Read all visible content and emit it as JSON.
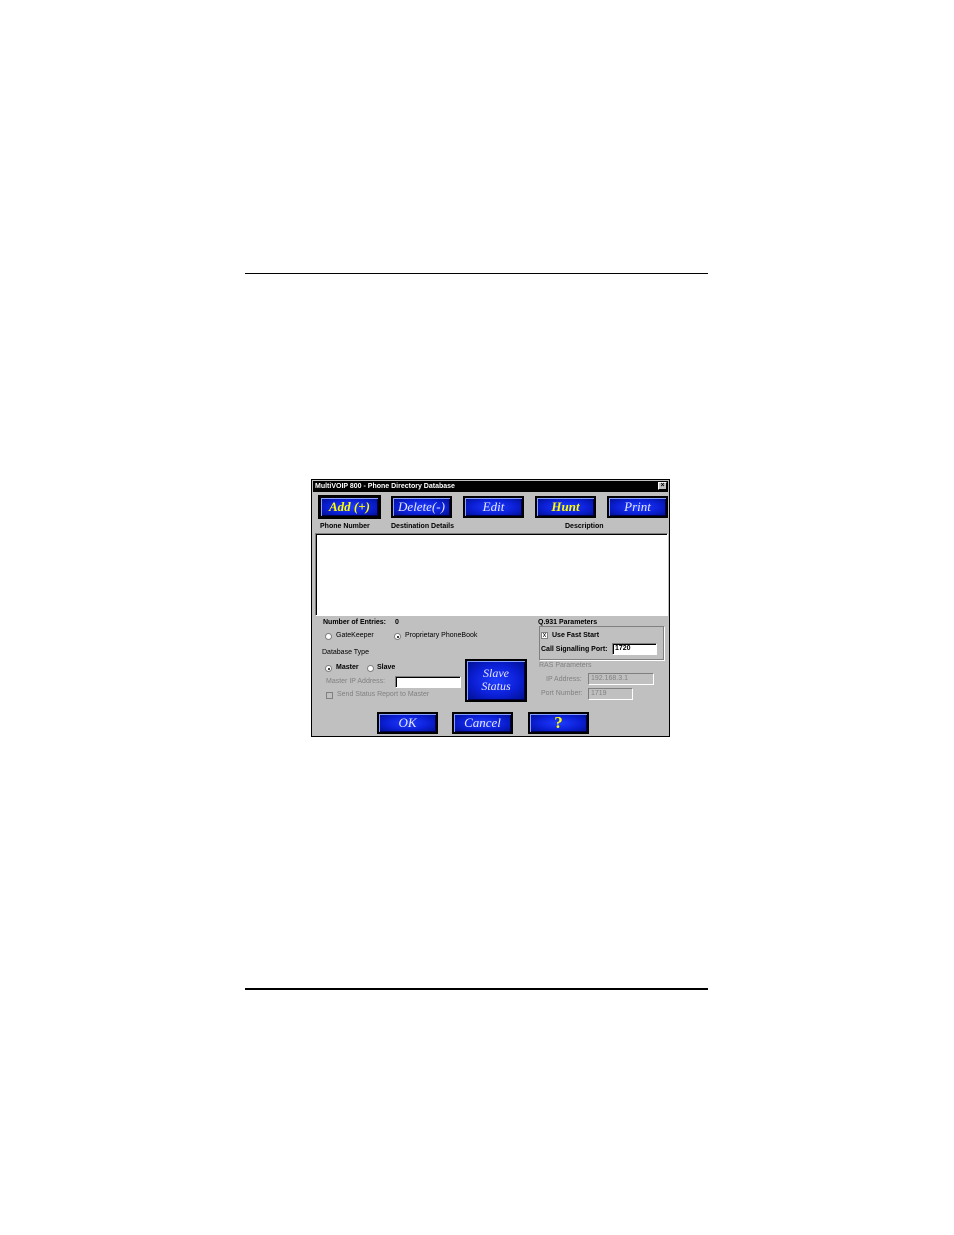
{
  "window": {
    "title": "MultiVOIP 800 - Phone Directory Database",
    "close_glyph": "×"
  },
  "toolbar": {
    "add": "Add (+)",
    "delete": "Delete(-)",
    "edit": "Edit",
    "hunt": "Hunt",
    "print": "Print"
  },
  "columns": {
    "phone_number": "Phone Number",
    "destination_details": "Destination Details",
    "description": "Description"
  },
  "entries": {
    "label": "Number of Entries:",
    "count": "0"
  },
  "mode": {
    "gatekeeper": "GateKeeper",
    "proprietary": "Proprietary PhoneBook",
    "selected": "proprietary"
  },
  "database_type": {
    "label": "Database Type",
    "master": "Master",
    "slave": "Slave",
    "selected": "master",
    "master_ip_label": "Master IP Address:",
    "master_ip_value": "",
    "send_status_label": "Send Status Report to Master",
    "slave_status_line1": "Slave",
    "slave_status_line2": "Status"
  },
  "q931": {
    "label": "Q.931 Parameters",
    "use_fast_start": "Use Fast Start",
    "use_fast_start_checked": true,
    "check_glyph": "x",
    "call_signalling_label": "Call Signalling Port:",
    "call_signalling_value": "1720"
  },
  "ras": {
    "label": "RAS Parameters",
    "ip_label": "IP Address:",
    "ip_value": "192.168.3.1",
    "port_label": "Port Number:",
    "port_value": "1719"
  },
  "footer": {
    "ok": "OK",
    "cancel": "Cancel",
    "help": "?"
  }
}
